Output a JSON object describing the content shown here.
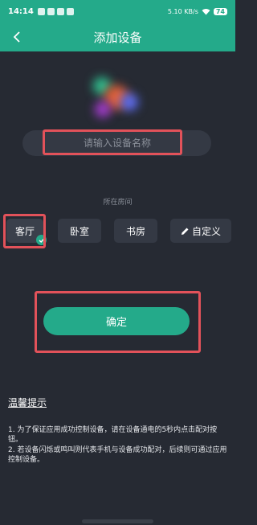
{
  "status_bar": {
    "time": "14:14",
    "network_speed": "5.10 KB/s",
    "battery": "74"
  },
  "header": {
    "title": "添加设备"
  },
  "device_name_input": {
    "placeholder": "请输入设备名称",
    "value": ""
  },
  "room_section": {
    "label": "所在房间",
    "rooms": [
      {
        "label": "客厅",
        "selected": true
      },
      {
        "label": "卧室",
        "selected": false
      },
      {
        "label": "书房",
        "selected": false
      },
      {
        "label": "自定义",
        "selected": false
      }
    ]
  },
  "confirm_button": {
    "label": "确定"
  },
  "tips": {
    "title": "温馨提示",
    "items": [
      "1. 为了保证应用成功控制设备，请在设备通电的5秒内点击配对按钮。",
      "2. 若设备闪烁或鸣叫则代表手机与设备成功配对，后续则可通过应用控制设备。"
    ]
  },
  "colors": {
    "accent": "#24aa8a",
    "background": "#262a33",
    "surface": "#343944",
    "highlight": "#e2525a"
  }
}
